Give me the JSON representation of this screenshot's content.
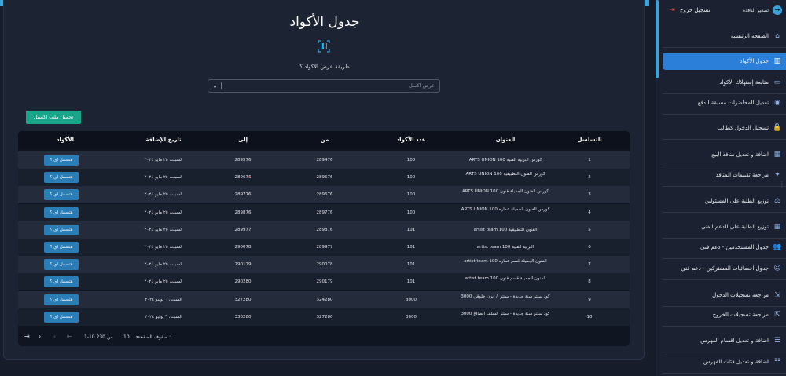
{
  "page": {
    "title": "جدول الأكواد",
    "view_label": "طريقة عرض الأكواد ؟",
    "select_placeholder": "عرض اكسل",
    "upload_button": "تحميل ملف اكسيل",
    "barcode_icon": "barcode-icon"
  },
  "table": {
    "headers": {
      "serial": "التسلسل",
      "title": "العنوان",
      "count": "عدد الأكواد",
      "from": "من",
      "to": "إلى",
      "date": "تاريخ الإضافة",
      "codes": "الأكواد"
    },
    "rows": [
      {
        "serial": "1",
        "title": "ARTS UNION 100 كورس التربيه الفنيه",
        "count": "100",
        "from": "289476",
        "to": "289576",
        "date": "السبت، ٢٥ مايو ٢٠٢٤",
        "codes": "هتسمل اي ؟"
      },
      {
        "serial": "2",
        "title": "ARTS UNION 100 كورس الفنون التطبيقية",
        "count": "100",
        "from": "289576",
        "to": "289676",
        "date": "السبت، ٢٥ مايو ٢٠٢٤",
        "codes": "هتسمل اي ؟"
      },
      {
        "serial": "3",
        "title": "ARTS UNION 100 كورس الفنون الجميلة فنون",
        "count": "100",
        "from": "289676",
        "to": "289776",
        "date": "السبت، ٢٥ مايو ٢٠٢٤",
        "codes": "هتسمل اي ؟"
      },
      {
        "serial": "4",
        "title": "ARTS UNION 100 كورس الفنون الجميلة عماره",
        "count": "100",
        "from": "289776",
        "to": "289876",
        "date": "السبت، ٢٥ مايو ٢٠٢٤",
        "codes": "هتسمل اي ؟"
      },
      {
        "serial": "5",
        "title": "artist team 100 الفنون التطبيقية",
        "count": "101",
        "from": "289876",
        "to": "289977",
        "date": "السبت، ٢٥ مايو ٢٠٢٤",
        "codes": "هتسمل اي ؟"
      },
      {
        "serial": "6",
        "title": "artist team 100 التربيه الفنيه",
        "count": "101",
        "from": "289977",
        "to": "290078",
        "date": "السبت، ٢٥ مايو ٢٠٢٤",
        "codes": "هتسمل اي ؟"
      },
      {
        "serial": "7",
        "title": "artist team 100 الفنون الجميلة قسم عماره",
        "count": "101",
        "from": "290078",
        "to": "290179",
        "date": "السبت، ٢٥ مايو ٢٠٢٤",
        "codes": "هتسمل اي ؟"
      },
      {
        "serial": "8",
        "title": "artist team 100 الفنون الجميلة قسم فنون",
        "count": "101",
        "from": "290179",
        "to": "290280",
        "date": "السبت، ٢٥ مايو ٢٠٢٤",
        "codes": "هتسمل اي ؟"
      },
      {
        "serial": "9",
        "title": "3000 كود سنتر سنة جديدة - سنتر أ/ ابرن خلوقي",
        "count": "3000",
        "from": "324280",
        "to": "327280",
        "date": "السبت، ٦ يوليو ٢٠٢٤",
        "codes": "هتسمل اي ؟"
      },
      {
        "serial": "10",
        "title": "3000 كود سنتر سنة جديدة - سنتر السلف الصالح",
        "count": "3000",
        "from": "327280",
        "to": "330280",
        "date": "السبت، ٦ يوليو ٢٠٢٤",
        "codes": "هتسمل اي ؟"
      }
    ]
  },
  "pager": {
    "rows_label": "صفوف الصفحة :",
    "rows_value": "10",
    "range": "1-10 من 230"
  },
  "sidebar": {
    "logout": "تسجيل خروج",
    "shrink": "تصغير النافذة",
    "items": [
      {
        "label": "الصفحة الرئيسية",
        "icon": "home-icon"
      },
      {
        "label": "جدول الأكواد",
        "icon": "barcode-icon"
      },
      {
        "label": "متابعة إستهلاك الأكواد",
        "icon": "monitor-icon"
      },
      {
        "label": "تعديل المحاضرات مسبقة الدفع",
        "icon": "eye-icon"
      },
      {
        "label": "تسجيل الدخول كطالب",
        "icon": "lock-icon"
      },
      {
        "label": "اضافة و تعديل منافذ البيع",
        "icon": "store-icon"
      },
      {
        "label": "مراجعة تقييمات المنافذ",
        "icon": "star-icon"
      },
      {
        "label": "توزيع الطلبة على المسئولين",
        "icon": "scale-icon"
      },
      {
        "label": "توزيع الطلبة على الدعم الفني",
        "icon": "grid-icon"
      },
      {
        "label": "جدول المستخدمين - دعم فني",
        "icon": "users-icon"
      },
      {
        "label": "جدول احصائيات المشتركين - دعم فني",
        "icon": "group-icon"
      },
      {
        "label": "مراجعة تسجيلات الدخول",
        "icon": "login-icon"
      },
      {
        "label": "مراجعة تسجيلات الخروج",
        "icon": "logout-icon"
      },
      {
        "label": "اضافة و تعديل اقسام الفهرس",
        "icon": "person-list-icon"
      },
      {
        "label": "اضافة و تعديل فئات الفهرس",
        "icon": "tag-list-icon"
      }
    ]
  }
}
